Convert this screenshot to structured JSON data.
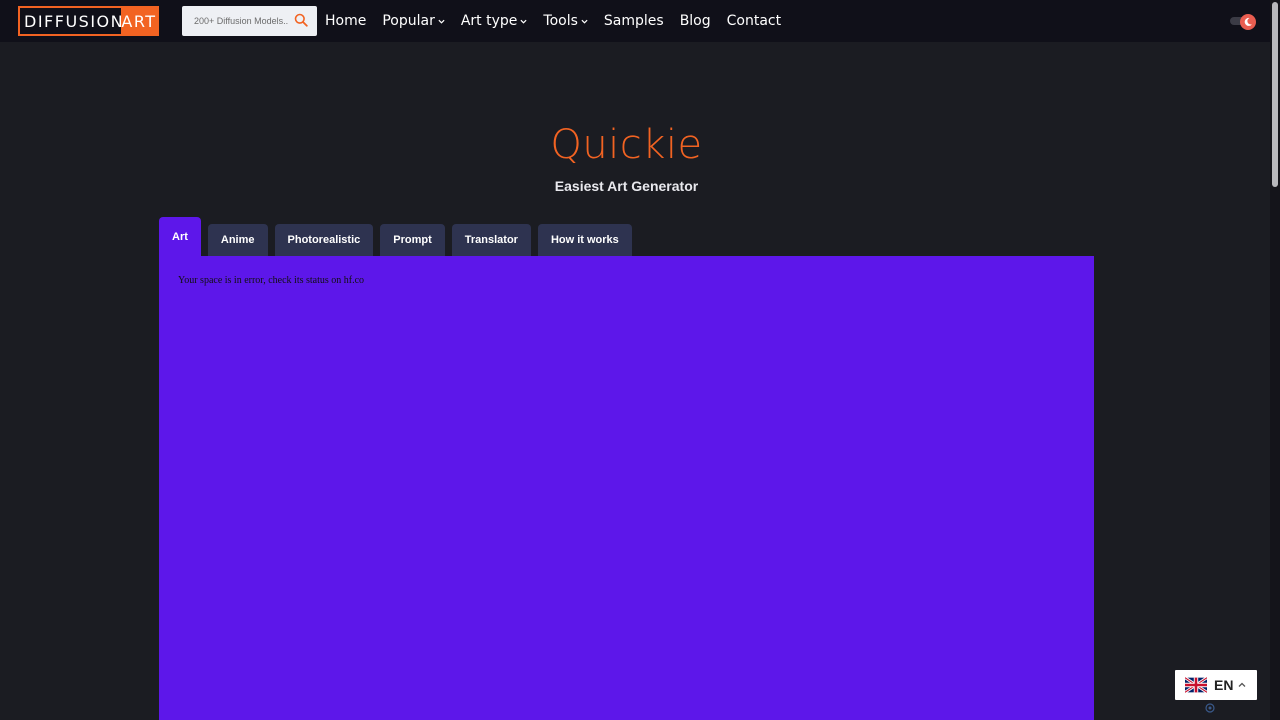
{
  "header": {
    "logo_left": "DIFFUSION",
    "logo_right": "ART",
    "search_placeholder": "200+ Diffusion Models..",
    "nav": [
      {
        "label": "Home",
        "dropdown": false
      },
      {
        "label": "Popular",
        "dropdown": true
      },
      {
        "label": "Art type",
        "dropdown": true
      },
      {
        "label": "Tools",
        "dropdown": true
      },
      {
        "label": "Samples",
        "dropdown": false
      },
      {
        "label": "Blog",
        "dropdown": false
      },
      {
        "label": "Contact",
        "dropdown": false
      }
    ],
    "theme_toggle_icon": "moon-icon"
  },
  "hero": {
    "title": "Quickie",
    "subtitle": "Easiest Art Generator"
  },
  "tabs": [
    {
      "label": "Art",
      "active": true
    },
    {
      "label": "Anime",
      "active": false
    },
    {
      "label": "Photorealistic",
      "active": false
    },
    {
      "label": "Prompt",
      "active": false
    },
    {
      "label": "Translator",
      "active": false
    },
    {
      "label": "How it works",
      "active": false
    }
  ],
  "panel": {
    "message": "Your space is in error, check its status on hf.co"
  },
  "language": {
    "label": "EN",
    "flag_icon": "uk-flag-icon"
  },
  "colors": {
    "accent": "#f26322",
    "panel": "#5d17ea",
    "tab": "#2e3350",
    "background": "#1b1c22",
    "header": "#101019"
  }
}
